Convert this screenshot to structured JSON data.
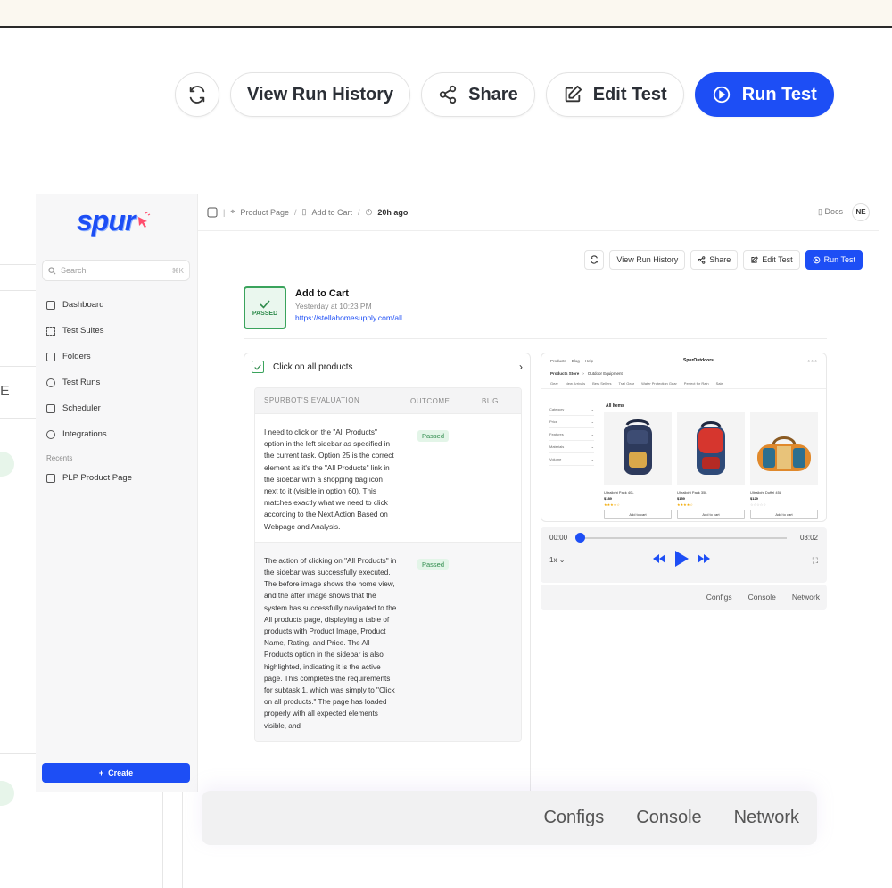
{
  "toolbar": {
    "refresh_icon": "refresh-icon",
    "view_history_label": "View Run History",
    "share_label": "Share",
    "edit_label": "Edit Test",
    "run_label": "Run Test"
  },
  "ghost": {
    "e_letter": "E"
  },
  "app": {
    "logo_text": "spur",
    "search_placeholder": "Search",
    "search_shortcut": "⌘K",
    "nav": [
      {
        "label": "Dashboard",
        "icon": "dashboard-icon"
      },
      {
        "label": "Test Suites",
        "icon": "test-suites-icon"
      },
      {
        "label": "Folders",
        "icon": "folder-icon"
      },
      {
        "label": "Test Runs",
        "icon": "test-runs-icon"
      },
      {
        "label": "Scheduler",
        "icon": "calendar-icon"
      },
      {
        "label": "Integrations",
        "icon": "integrations-icon"
      }
    ],
    "recents_label": "Recents",
    "recent_item": "PLP Product Page",
    "create_label": "Create",
    "breadcrumb": {
      "item1": "Product Page",
      "item2": "Add to Cart",
      "time": "20h ago"
    },
    "docs_label": "Docs",
    "avatar_initials": "NE",
    "small_toolbar": {
      "view_history_label": "View Run History",
      "share_label": "Share",
      "edit_label": "Edit Test",
      "run_label": "Run Test"
    },
    "test": {
      "status": "PASSED",
      "title": "Add to Cart",
      "time": "Yesterday at 10:23 PM",
      "url": "https://stellahomesupply.com/all"
    },
    "step": {
      "title": "Click on all products",
      "headers": {
        "eval": "SPURBOT'S EVALUATION",
        "outcome": "OUTCOME",
        "bug": "BUG"
      },
      "rows": [
        {
          "text": "I need to click on the \"All Products\" option in the left sidebar as specified in the current task. Option 25 is the correct element as it's the \"All Products\" link in the sidebar with a shopping bag icon next to it (visible in option 60). This matches exactly what we need to click according to the Next Action Based on Webpage and Analysis.",
          "outcome": "Passed"
        },
        {
          "text": "The action of clicking on \"All Products\" in the sidebar was successfully executed. The before image shows the home view, and the after image shows that the system has successfully navigated to the All products page, displaying a table of products with Product Image, Product Name, Rating, and Price. The All Products option in the sidebar is also highlighted, indicating it is the active page. This completes the requirements for subtask 1, which was simply to \"Click on all products.\" The page has loaded properly with all expected elements visible, and",
          "outcome": "Passed"
        }
      ]
    },
    "preview": {
      "nav_links": [
        "Products",
        "Blog",
        "Help"
      ],
      "brand": "SpurOutdoors",
      "crumb1": "Products Store",
      "crumb2": "Outdoor Equipment",
      "tabs": [
        "Gear",
        "New Arrivals",
        "Best Sellers",
        "Trail Gear",
        "Water Protection Gear",
        "Perfect for Rain",
        "Sale"
      ],
      "filters": [
        "Category",
        "Price",
        "Features",
        "Materials",
        "Volume"
      ],
      "heading": "All Items",
      "products": [
        {
          "name": "Ultralight Pack 40L",
          "price": "$189",
          "button": "Add to cart"
        },
        {
          "name": "Ultralight Pack 35L",
          "price": "$159",
          "button": "Add to cart"
        },
        {
          "name": "Ultralight Duffel 45L",
          "price": "$129",
          "button": "Add to cart"
        }
      ]
    },
    "player": {
      "current": "00:00",
      "total": "03:02",
      "speed": "1x",
      "progress": 0.0
    },
    "subtabs": [
      "Configs",
      "Console",
      "Network"
    ]
  },
  "bottom_tabs": [
    "Configs",
    "Console",
    "Network"
  ],
  "colors": {
    "accent": "#1d4ef5",
    "pass": "#2f8b4c"
  }
}
